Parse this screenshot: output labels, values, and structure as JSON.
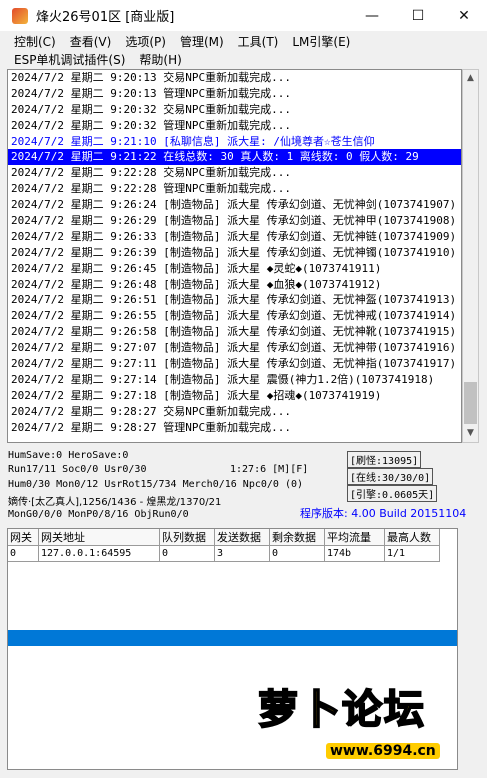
{
  "window": {
    "title": "烽火26号01区 [商业版]",
    "minimize": "—",
    "maximize": "☐",
    "close": "✕"
  },
  "menu": {
    "row1": [
      "控制(C)",
      "查看(V)",
      "选项(P)",
      "管理(M)",
      "工具(T)",
      "LM引擎(E)"
    ],
    "row2": [
      "ESP单机调试插件(S)",
      "帮助(H)"
    ]
  },
  "log": [
    {
      "text": "2024/7/2 星期二 9:20:13 交易NPC重新加载完成...",
      "style": "normal"
    },
    {
      "text": "2024/7/2 星期二 9:20:13 管理NPC重新加载完成...",
      "style": "normal"
    },
    {
      "text": "2024/7/2 星期二 9:20:32 交易NPC重新加载完成...",
      "style": "normal"
    },
    {
      "text": "2024/7/2 星期二 9:20:32 管理NPC重新加载完成...",
      "style": "normal"
    },
    {
      "text": "2024/7/2 星期二 9:21:10 [私聊信息] 派大星: /仙境尊者☆苍生信仰",
      "style": "blue"
    },
    {
      "text": "2024/7/2 星期二 9:21:22 在线总数: 30 真人数: 1 离线数: 0 假人数: 29",
      "style": "sel"
    },
    {
      "text": "2024/7/2 星期二 9:22:28 交易NPC重新加载完成...",
      "style": "normal"
    },
    {
      "text": "2024/7/2 星期二 9:22:28 管理NPC重新加载完成...",
      "style": "normal"
    },
    {
      "text": "2024/7/2 星期二 9:26:24 [制造物品] 派大星 传承幻剑道、无忧神剑(1073741907)",
      "style": "normal"
    },
    {
      "text": "2024/7/2 星期二 9:26:29 [制造物品] 派大星 传承幻剑道、无忧神甲(1073741908)",
      "style": "normal"
    },
    {
      "text": "2024/7/2 星期二 9:26:33 [制造物品] 派大星 传承幻剑道、无忧神链(1073741909)",
      "style": "normal"
    },
    {
      "text": "2024/7/2 星期二 9:26:39 [制造物品] 派大星 传承幻剑道、无忧神镯(1073741910)",
      "style": "normal"
    },
    {
      "text": "2024/7/2 星期二 9:26:45 [制造物品] 派大星 ◆灵蛇◆(1073741911)",
      "style": "normal"
    },
    {
      "text": "2024/7/2 星期二 9:26:48 [制造物品] 派大星 ◆血狼◆(1073741912)",
      "style": "normal"
    },
    {
      "text": "2024/7/2 星期二 9:26:51 [制造物品] 派大星 传承幻剑道、无忧神盔(1073741913)",
      "style": "normal"
    },
    {
      "text": "2024/7/2 星期二 9:26:55 [制造物品] 派大星 传承幻剑道、无忧神戒(1073741914)",
      "style": "normal"
    },
    {
      "text": "2024/7/2 星期二 9:26:58 [制造物品] 派大星 传承幻剑道、无忧神靴(1073741915)",
      "style": "normal"
    },
    {
      "text": "2024/7/2 星期二 9:27:07 [制造物品] 派大星 传承幻剑道、无忧神带(1073741916)",
      "style": "normal"
    },
    {
      "text": "2024/7/2 星期二 9:27:11 [制造物品] 派大星 传承幻剑道、无忧神指(1073741917)",
      "style": "normal"
    },
    {
      "text": "2024/7/2 星期二 9:27:14 [制造物品] 派大星 震慑(神力1.2倍)(1073741918)",
      "style": "normal"
    },
    {
      "text": "2024/7/2 星期二 9:27:18 [制造物品] 派大星 ◆招魂◆(1073741919)",
      "style": "normal"
    },
    {
      "text": "2024/7/2 星期二 9:28:27 交易NPC重新加载完成...",
      "style": "normal"
    },
    {
      "text": "2024/7/2 星期二 9:28:27 管理NPC重新加载完成...",
      "style": "normal"
    }
  ],
  "status": {
    "line1": "HumSave:0 HeroSave:0",
    "line2": "Run17/11 Soc0/0 Usr0/30",
    "time": "1:27:6 [M][F]",
    "line3": "Hum0/30 Mon0/12 UsrRot15/734 Merch0/16 Npc0/0 (0)",
    "line4": "嫡传·[太乙真人],1256/1436 - 煌黑龙/1370/21",
    "line5": "MonG0/0/0 MonP0/8/16 ObjRun0/0",
    "refresh": "[刷怪:13095]",
    "online": "[在线:30/30/0]",
    "engine": "[引擎:0.0605天]",
    "version": "程序版本: 4.00 Build 20151104"
  },
  "grid": {
    "headers": [
      "网关",
      "网关地址",
      "队列数据",
      "发送数据",
      "剩余数据",
      "平均流量",
      "最高人数"
    ],
    "rows": [
      [
        "0",
        "127.0.0.1:64595",
        "0",
        "3",
        "0",
        "174b",
        "1/1"
      ]
    ]
  },
  "watermark": {
    "text": "萝卜论坛",
    "url": "www.6994.cn",
    "color": "#ffcc00"
  }
}
